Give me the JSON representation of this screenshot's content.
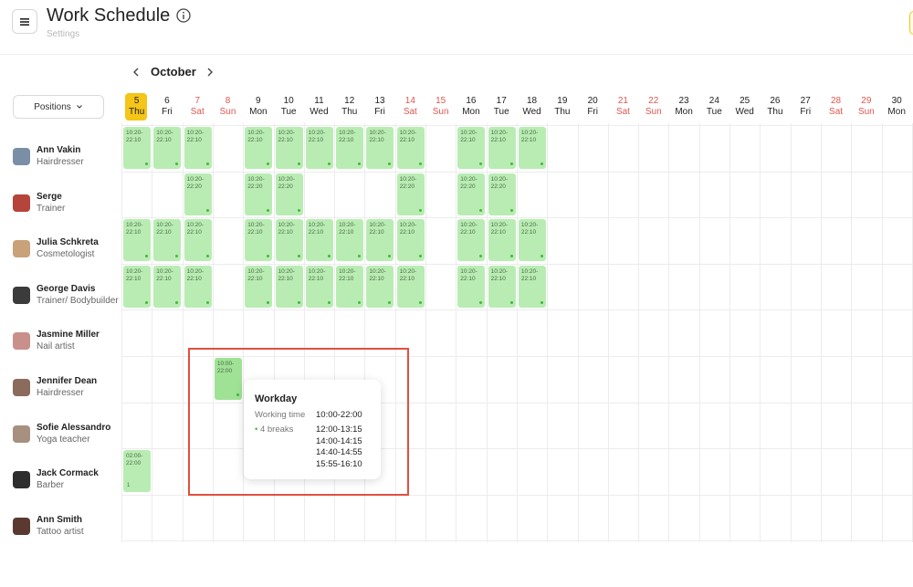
{
  "header": {
    "title": "Work Schedule",
    "subtitle": "Settings"
  },
  "filters": {
    "positions_label": "Positions"
  },
  "calendar": {
    "month": "October",
    "days": [
      {
        "num": "5",
        "wd": "Thu",
        "weekend": false,
        "today": true
      },
      {
        "num": "6",
        "wd": "Fri",
        "weekend": false
      },
      {
        "num": "7",
        "wd": "Sat",
        "weekend": true
      },
      {
        "num": "8",
        "wd": "Sun",
        "weekend": true
      },
      {
        "num": "9",
        "wd": "Mon",
        "weekend": false
      },
      {
        "num": "10",
        "wd": "Tue",
        "weekend": false
      },
      {
        "num": "11",
        "wd": "Wed",
        "weekend": false
      },
      {
        "num": "12",
        "wd": "Thu",
        "weekend": false
      },
      {
        "num": "13",
        "wd": "Fri",
        "weekend": false
      },
      {
        "num": "14",
        "wd": "Sat",
        "weekend": true
      },
      {
        "num": "15",
        "wd": "Sun",
        "weekend": true
      },
      {
        "num": "16",
        "wd": "Mon",
        "weekend": false
      },
      {
        "num": "17",
        "wd": "Tue",
        "weekend": false
      },
      {
        "num": "18",
        "wd": "Wed",
        "weekend": false
      },
      {
        "num": "19",
        "wd": "Thu",
        "weekend": false
      },
      {
        "num": "20",
        "wd": "Fri",
        "weekend": false
      },
      {
        "num": "21",
        "wd": "Sat",
        "weekend": true
      },
      {
        "num": "22",
        "wd": "Sun",
        "weekend": true
      },
      {
        "num": "23",
        "wd": "Mon",
        "weekend": false
      },
      {
        "num": "24",
        "wd": "Tue",
        "weekend": false
      },
      {
        "num": "25",
        "wd": "Wed",
        "weekend": false
      },
      {
        "num": "26",
        "wd": "Thu",
        "weekend": false
      },
      {
        "num": "27",
        "wd": "Fri",
        "weekend": false
      },
      {
        "num": "28",
        "wd": "Sat",
        "weekend": true
      },
      {
        "num": "29",
        "wd": "Sun",
        "weekend": true
      },
      {
        "num": "30",
        "wd": "Mon",
        "weekend": false
      }
    ]
  },
  "staff": [
    {
      "name": "Ann Vakin",
      "role": "Hairdresser",
      "shifts": [
        {
          "day": 0,
          "time": "10:20-\n22:10"
        },
        {
          "day": 1,
          "time": "10:20-\n22:10"
        },
        {
          "day": 2,
          "time": "10:20-\n22:10"
        },
        {
          "day": 4,
          "time": "10:20-\n22:10"
        },
        {
          "day": 5,
          "time": "10:20-\n22:10"
        },
        {
          "day": 6,
          "time": "10:20-\n22:10"
        },
        {
          "day": 7,
          "time": "10:20-\n22:10"
        },
        {
          "day": 8,
          "time": "10:20-\n22:10"
        },
        {
          "day": 9,
          "time": "10:20-\n22:10"
        },
        {
          "day": 11,
          "time": "10:20-\n22:10"
        },
        {
          "day": 12,
          "time": "10:20-\n22:10"
        },
        {
          "day": 13,
          "time": "10:20-\n22:10"
        }
      ]
    },
    {
      "name": "Serge",
      "role": "Trainer",
      "shifts": [
        {
          "day": 2,
          "time": "10:20-\n22:20"
        },
        {
          "day": 4,
          "time": "10:20-\n22:20"
        },
        {
          "day": 5,
          "time": "10:20-\n22:20"
        },
        {
          "day": 9,
          "time": "10:20-\n22:20"
        },
        {
          "day": 11,
          "time": "10:20-\n22:20"
        },
        {
          "day": 12,
          "time": "10:20-\n22:20"
        }
      ]
    },
    {
      "name": "Julia Schkreta",
      "role": "Cosmetologist",
      "shifts": [
        {
          "day": 0,
          "time": "10:20-\n22:10"
        },
        {
          "day": 1,
          "time": "10:20-\n22:10"
        },
        {
          "day": 2,
          "time": "10:20-\n22:10"
        },
        {
          "day": 4,
          "time": "10:20-\n22:10"
        },
        {
          "day": 5,
          "time": "10:20-\n22:10"
        },
        {
          "day": 6,
          "time": "10:20-\n22:10"
        },
        {
          "day": 7,
          "time": "10:20-\n22:10"
        },
        {
          "day": 8,
          "time": "10:20-\n22:10"
        },
        {
          "day": 9,
          "time": "10:20-\n22:10"
        },
        {
          "day": 11,
          "time": "10:20-\n22:10"
        },
        {
          "day": 12,
          "time": "10:20-\n22:10"
        },
        {
          "day": 13,
          "time": "10:20-\n22:10"
        }
      ]
    },
    {
      "name": "George Davis",
      "role": "Trainer/ Bodybuilder",
      "shifts": [
        {
          "day": 0,
          "time": "10:20-\n22:10"
        },
        {
          "day": 1,
          "time": "10:20-\n22:10"
        },
        {
          "day": 2,
          "time": "10:20-\n22:10"
        },
        {
          "day": 4,
          "time": "10:20-\n22:10"
        },
        {
          "day": 5,
          "time": "10:20-\n22:10"
        },
        {
          "day": 6,
          "time": "10:20-\n22:10"
        },
        {
          "day": 7,
          "time": "10:20-\n22:10"
        },
        {
          "day": 8,
          "time": "10:20-\n22:10"
        },
        {
          "day": 9,
          "time": "10:20-\n22:10"
        },
        {
          "day": 11,
          "time": "10:20-\n22:10"
        },
        {
          "day": 12,
          "time": "10:20-\n22:10"
        },
        {
          "day": 13,
          "time": "10:20-\n22:10"
        }
      ]
    },
    {
      "name": "Jasmine Miller",
      "role": "Nail artist",
      "shifts": []
    },
    {
      "name": "Jennifer Dean",
      "role": "Hairdresser",
      "shifts": [
        {
          "day": 3,
          "time": "10:00-\n22:00",
          "dark": true
        }
      ]
    },
    {
      "name": "Sofie Alessandro",
      "role": "Yoga teacher",
      "shifts": []
    },
    {
      "name": "Jack Cormack",
      "role": "Barber",
      "shifts": [
        {
          "day": 0,
          "time": "02:00-\n22:00",
          "one": "1"
        }
      ]
    },
    {
      "name": "Ann Smith",
      "role": "Tattoo artist",
      "shifts": []
    }
  ],
  "tooltip": {
    "title": "Workday",
    "working_time_label": "Working time",
    "working_time": "10:00-22:00",
    "breaks_label": "4 breaks",
    "breaks": [
      "12:00-13:15",
      "14:00-14:15",
      "14:40-14:55",
      "15:55-16:10"
    ]
  },
  "colors": {
    "accent": "#f5c518",
    "shift": "#b9ecb3",
    "weekend": "#e0574f",
    "highlight": "#e0503f"
  }
}
